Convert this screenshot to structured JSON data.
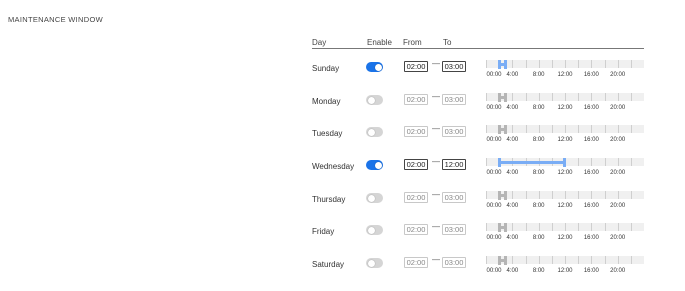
{
  "section_title": "MAINTENANCE WINDOW",
  "header": {
    "day": "Day",
    "enable": "Enable",
    "from": "From",
    "to": "To"
  },
  "separator": "—",
  "axis_labels": [
    "00:00",
    "4:00",
    "8:00",
    "12:00",
    "16:00",
    "20:00"
  ],
  "rows": [
    {
      "day": "Sunday",
      "enabled": true,
      "from": "02:00",
      "to": "03:00"
    },
    {
      "day": "Monday",
      "enabled": false,
      "from": "02:00",
      "to": "03:00"
    },
    {
      "day": "Tuesday",
      "enabled": false,
      "from": "02:00",
      "to": "03:00"
    },
    {
      "day": "Wednesday",
      "enabled": true,
      "from": "02:00",
      "to": "12:00"
    },
    {
      "day": "Thursday",
      "enabled": false,
      "from": "02:00",
      "to": "03:00"
    },
    {
      "day": "Friday",
      "enabled": false,
      "from": "02:00",
      "to": "03:00"
    },
    {
      "day": "Saturday",
      "enabled": false,
      "from": "02:00",
      "to": "03:00"
    }
  ],
  "colors": {
    "accent": "#1a73e8",
    "range_active": "#7aadf5",
    "range_disabled": "#b5b5b5",
    "toggle_off": "#d5d5d5"
  }
}
